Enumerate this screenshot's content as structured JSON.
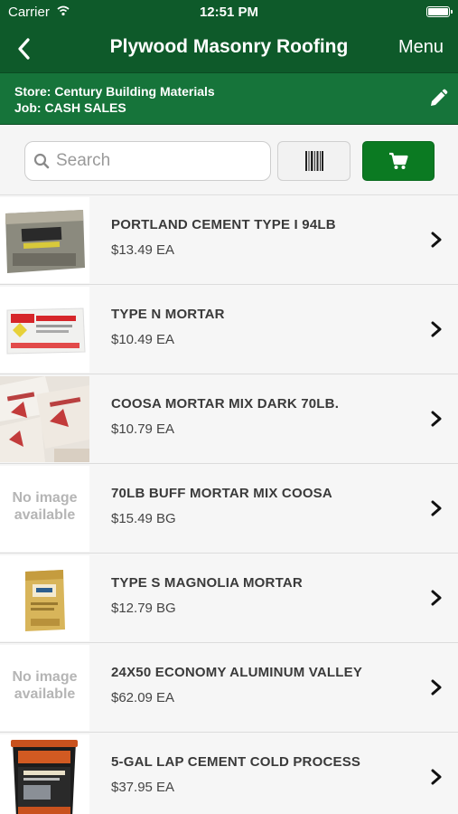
{
  "status": {
    "carrier": "Carrier",
    "time": "12:51 PM"
  },
  "nav": {
    "title": "Plywood Masonry Roofing",
    "menu_label": "Menu",
    "back_icon": "chevron-left-icon"
  },
  "store": {
    "store_line": "Store: Century Building Materials",
    "job_line": "Job: CASH SALES"
  },
  "search": {
    "placeholder": "Search",
    "value": ""
  },
  "colors": {
    "header": "#0e5a2a",
    "store_bar": "#16743a",
    "cart_button": "#0b7a22"
  },
  "items": [
    {
      "name": "PORTLAND CEMENT TYPE I 94LB",
      "price": "$13.49 EA",
      "image": "cement-bag"
    },
    {
      "name": "TYPE N MORTAR",
      "price": "$10.49 EA",
      "image": "mortar-bag"
    },
    {
      "name": "COOSA MORTAR MIX DARK 70LB.",
      "price": "$10.79 EA",
      "image": "coosa-bags"
    },
    {
      "name": "70LB BUFF MORTAR MIX COOSA",
      "price": "$15.49 BG",
      "image": "none",
      "no_image_text": "No image available"
    },
    {
      "name": "TYPE S MAGNOLIA MORTAR",
      "price": "$12.79 BG",
      "image": "magnolia-bag"
    },
    {
      "name": "24X50 ECONOMY ALUMINUM VALLEY",
      "price": "$62.09 EA",
      "image": "none",
      "no_image_text": "No image available"
    },
    {
      "name": "5-GAL LAP CEMENT COLD PROCESS",
      "price": "$37.95 EA",
      "image": "gardner-bucket"
    }
  ]
}
